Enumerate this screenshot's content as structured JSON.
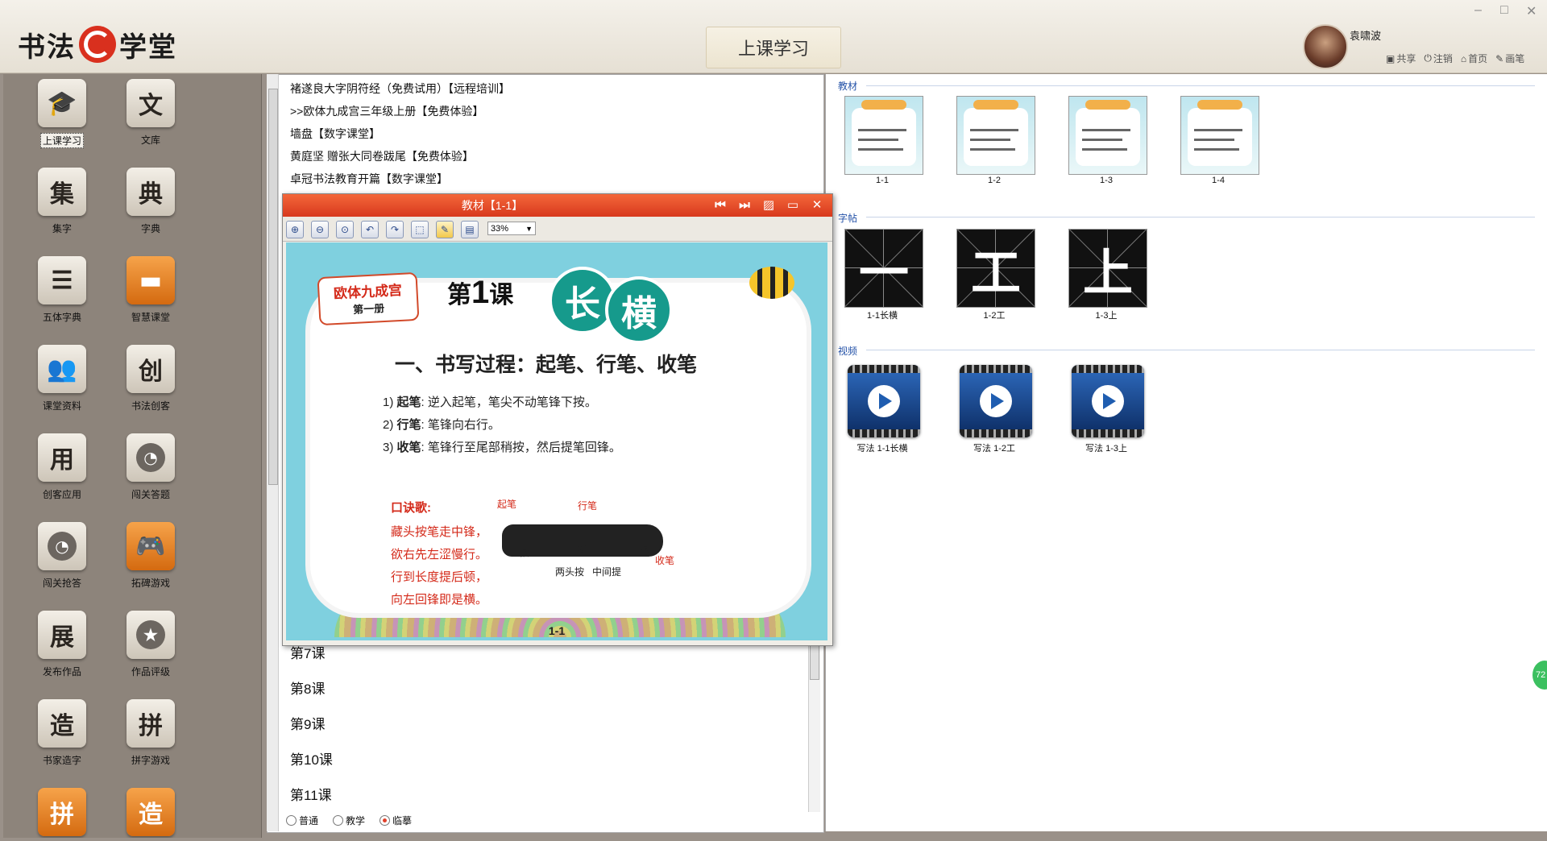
{
  "app": {
    "logo_left": "书法",
    "logo_right": "学堂",
    "page_title": "上课学习",
    "window_controls": [
      "–",
      "□",
      "✕"
    ]
  },
  "user": {
    "name": "袁啸波",
    "links": [
      {
        "icon": "share-icon",
        "glyph": "▣",
        "label": "共享"
      },
      {
        "icon": "logout-icon",
        "glyph": "⏻",
        "label": "注销"
      },
      {
        "icon": "home-icon",
        "glyph": "⌂",
        "label": "首页"
      },
      {
        "icon": "pen-icon",
        "glyph": "✎",
        "label": "画笔"
      }
    ]
  },
  "sidebar": {
    "items": [
      {
        "glyph": "🎓",
        "label": "上课学习",
        "style": "normal",
        "active": true
      },
      {
        "glyph": "文",
        "label": "文库",
        "style": "normal"
      },
      {
        "glyph": "集",
        "label": "集字",
        "style": "normal"
      },
      {
        "glyph": "典",
        "label": "字典",
        "style": "normal"
      },
      {
        "glyph": "☰",
        "label": "五体字典",
        "style": "normal"
      },
      {
        "glyph": "▬",
        "label": "智慧课堂",
        "style": "orange"
      },
      {
        "glyph": "👥",
        "label": "课堂资料",
        "style": "normal"
      },
      {
        "glyph": "创",
        "label": "书法创客",
        "style": "normal"
      },
      {
        "glyph": "用",
        "label": "创客应用",
        "style": "normal"
      },
      {
        "glyph": "◔",
        "label": "闯关答题",
        "style": "round"
      },
      {
        "glyph": "◔",
        "label": "闯关抢答",
        "style": "round"
      },
      {
        "glyph": "🎮",
        "label": "拓碑游戏",
        "style": "orange"
      },
      {
        "glyph": "展",
        "label": "发布作品",
        "style": "normal"
      },
      {
        "glyph": "★",
        "label": "作品评级",
        "style": "round"
      },
      {
        "glyph": "造",
        "label": "书家造字",
        "style": "normal"
      },
      {
        "glyph": "拼",
        "label": "拼字游戏",
        "style": "normal"
      },
      {
        "glyph": "拼",
        "label": "",
        "style": "orange"
      },
      {
        "glyph": "造",
        "label": "",
        "style": "orange"
      }
    ]
  },
  "courses": [
    "褚遂良大字阴符经（免费试用）【远程培训】",
    ">>欧体九成宫三年级上册【免费体验】",
    "墙盘【数字课堂】",
    "黄庭坚 赠张大同卷跋尾【免费体验】",
    "卓冠书法教育开篇【数字课堂】"
  ],
  "lessons": [
    "第7课",
    "第8课",
    "第9课",
    "第10课",
    "第11课"
  ],
  "modes": [
    {
      "label": "普通",
      "checked": false
    },
    {
      "label": "教学",
      "checked": false
    },
    {
      "label": "临摹",
      "checked": true
    }
  ],
  "resources": {
    "textbook": {
      "title": "教材",
      "items": [
        "1-1",
        "1-2",
        "1-3",
        "1-4"
      ]
    },
    "copybook": {
      "title": "字帖",
      "items": [
        {
          "glyph": "一",
          "label": "1-1长横"
        },
        {
          "glyph": "工",
          "label": "1-2工"
        },
        {
          "glyph": "上",
          "label": "1-3上"
        }
      ]
    },
    "video": {
      "title": "视频",
      "items": [
        "写法 1-1长横",
        "写法 1-2工",
        "写法 1-3上"
      ]
    }
  },
  "viewer": {
    "title": "教材【1-1】",
    "zoom": "33%",
    "tool_icons": [
      "zoom-in-icon",
      "zoom-out-icon",
      "zoom-fit-icon",
      "rotate-left-icon",
      "rotate-right-icon",
      "select-icon",
      "pen-icon",
      "image-icon"
    ],
    "tool_glyphs": [
      "⊕",
      "⊖",
      "⊙",
      "↶",
      "↷",
      "⬚",
      "✎",
      "▤"
    ],
    "slide": {
      "book_title": "欧体九成宫",
      "book_volume": "第一册",
      "lesson_prefix": "第",
      "lesson_num": "1",
      "lesson_suffix": "课",
      "char1": "长",
      "char2": "横",
      "heading": "一、书写过程：起笔、行笔、收笔",
      "steps": [
        {
          "no": "1)",
          "key": "起笔",
          "text": ": 逆入起笔，笔尖不动笔锋下按。"
        },
        {
          "no": "2)",
          "key": "行笔",
          "text": ": 笔锋向右行。"
        },
        {
          "no": "3)",
          "key": "收笔",
          "text": ": 笔锋行至尾部稍按，然后提笔回锋。"
        }
      ],
      "poem_title": "口诀歌:",
      "poem": [
        "藏头按笔走中锋，",
        "欲右先左涩慢行。",
        "行到长度提后顿，",
        "向左回锋即是横。"
      ],
      "labels": {
        "start": "起笔",
        "move": "行笔",
        "end": "收笔",
        "press1": "按",
        "lift": "提",
        "press2": "按",
        "note": "两头按   中间提"
      },
      "page": "1-1"
    }
  },
  "edge_badge": "72"
}
